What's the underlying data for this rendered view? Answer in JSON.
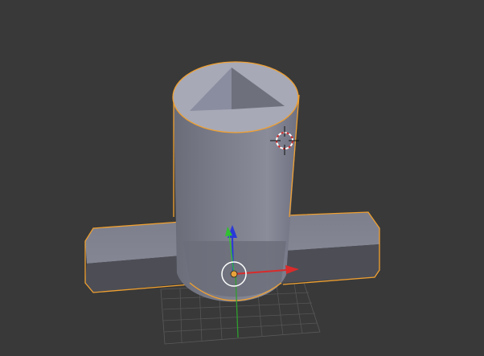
{
  "viewport": {
    "background": "#393939",
    "selection_outline_color": "#f0a030",
    "object_top_color": "#8d8f9d",
    "object_side_color": "#6f717e",
    "object_dark_color": "#4a4b52",
    "icons": {
      "cursor": "3d-cursor-icon",
      "x_axis": "x-axis-arrow-icon",
      "y_axis": "y-axis-arrow-icon",
      "z_axis": "z-axis-arrow-icon",
      "origin": "object-origin-icon"
    },
    "axis_colors": {
      "x": "#d92b2b",
      "y": "#30c030",
      "z": "#2a3ad8"
    }
  }
}
